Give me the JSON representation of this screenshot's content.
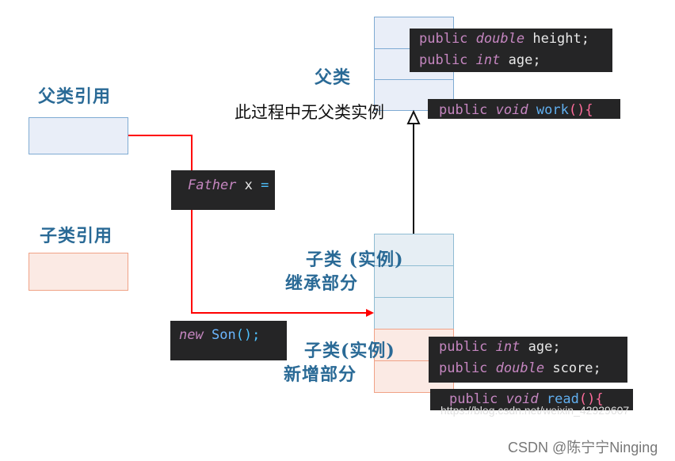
{
  "labels": {
    "father_ref": "父类引用",
    "son_ref": "子类引用",
    "father_class": "父类",
    "no_father_instance": "此过程中无父类实例",
    "son_instance_inherited_line1": "子类 (实例)",
    "son_instance_inherited_line2": "继承部分",
    "son_instance_new_line1": "子类(实例)",
    "son_instance_new_line2": "新增部分"
  },
  "code": {
    "father_fields": {
      "line1": {
        "kw": "public",
        "type": "double",
        "name": "height",
        "end": ";"
      },
      "line2": {
        "kw": "public",
        "type": "int",
        "name": "age",
        "end": ";"
      }
    },
    "father_method": {
      "kw": "public",
      "type": "void",
      "name": "work",
      "parens": "()",
      "brace": "{"
    },
    "declaration": {
      "type": "Father",
      "var": "x",
      "op": "="
    },
    "instantiation": {
      "kw": "new",
      "cls": "Son",
      "parens": "()",
      "end": ";"
    },
    "son_fields": {
      "line1": {
        "kw": "public",
        "type": "int",
        "name": "age",
        "end": ";"
      },
      "line2": {
        "kw": "public",
        "type": "double",
        "name": "score",
        "end": ";"
      }
    },
    "son_method": {
      "kw": "public",
      "type": "void",
      "name": "read",
      "parens": "()",
      "brace": "{"
    }
  },
  "watermark": {
    "url": "https://blog.csdn.net/weixin_42929607",
    "credit": "CSDN @陈宁宁Ninging"
  },
  "colors": {
    "reference_arrow": "#ff0000",
    "inheritance_arrow": "#111111",
    "father_fill": "#e9eef8",
    "son_new_fill": "#fbeae4",
    "code_bg": "#252526"
  }
}
